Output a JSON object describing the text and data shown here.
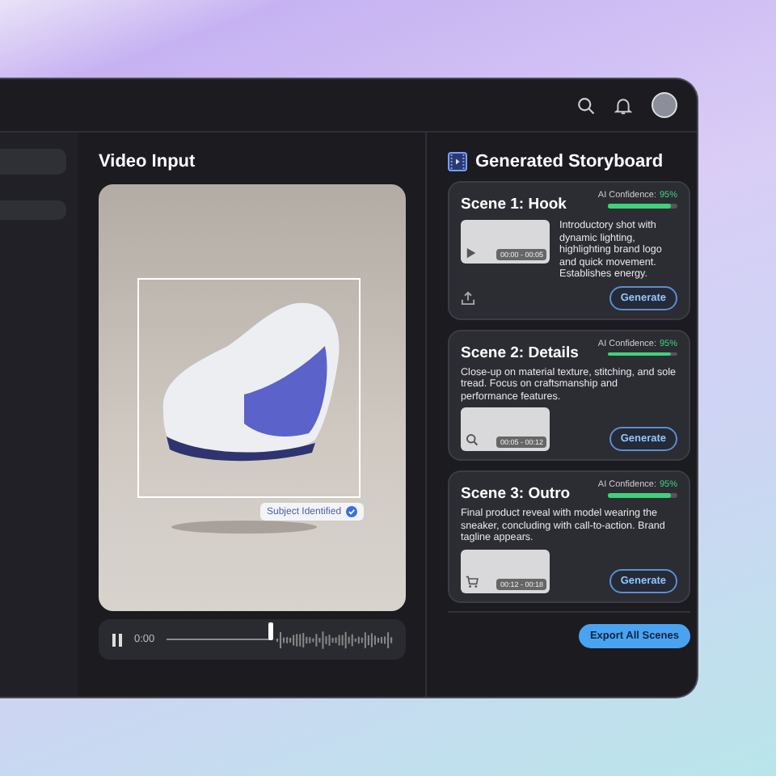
{
  "video_input": {
    "title": "Video Input",
    "detection_label": "Subject Identified",
    "player": {
      "time": "0:00",
      "level": 0.46,
      "playing": true
    }
  },
  "storyboard": {
    "title": "Generated Storyboard",
    "scenes": [
      {
        "kind": "side",
        "title": "Scene 1: Hook",
        "confidence_label": "AI Confidence:",
        "confidence": "95%",
        "level": 0.9,
        "description": "Introductory shot with dynamic lighting, highlighting brand logo and quick movement. Establishes energy.",
        "timecode": "00:00 - 00:05",
        "button": "Generate"
      },
      {
        "kind": "stacked",
        "title": "Scene 2: Details",
        "confidence_label": "AI Confidence:",
        "confidence": "95%",
        "level": 0.9,
        "description": "Close-up on material texture, stitching, and sole tread. Focus on craftsmanship and performance features.",
        "timecode": "00:05 - 00:12",
        "button": "Generate"
      },
      {
        "kind": "stacked",
        "title": "Scene 3: Outro",
        "confidence_label": "AI Confidence:",
        "confidence": "95%",
        "level": 0.9,
        "description": "Final product reveal with model wearing the sneaker, concluding with call-to-action. Brand tagline appears.",
        "timecode": "00:12 - 00:18",
        "button": "Generate"
      }
    ],
    "export_button": "Export All Scenes"
  }
}
